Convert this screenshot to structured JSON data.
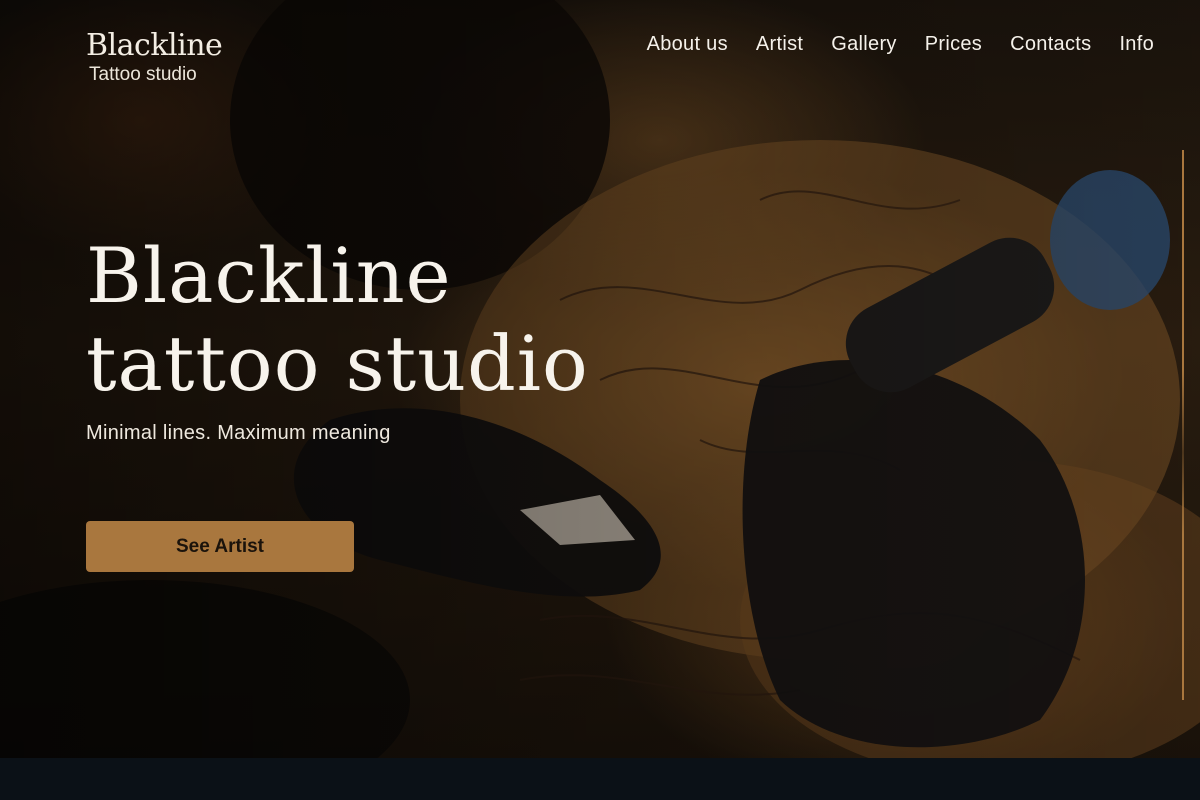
{
  "brand": {
    "name": "Blackline",
    "subtitle": "Tattoo studio"
  },
  "nav": {
    "items": [
      "About us",
      "Artist",
      "Gallery",
      "Prices",
      "Contacts",
      "Info"
    ]
  },
  "hero": {
    "headline_line1": "Blackline",
    "headline_line2": "tattoo studio",
    "tagline": "Minimal lines. Maximum meaning",
    "cta_label": "See Artist",
    "background_image": "tattoo-artist-at-work-photo"
  },
  "colors": {
    "accent": "#a9773e",
    "footer_band": "#0b1117",
    "text": "#f7f3ec"
  }
}
